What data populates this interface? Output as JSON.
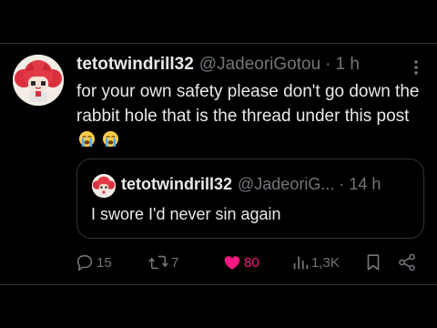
{
  "tweet": {
    "display_name": "tetotwindrill32",
    "handle": "@JadeoriGotou",
    "separator": "·",
    "time": "1 h",
    "text": "for your own safety please don't go down the rabbit hole that is the thread under this post",
    "emoji": "loudly-crying-face-icon"
  },
  "quote": {
    "display_name": "tetotwindrill32",
    "handle": "@JadeoriG...",
    "separator": "·",
    "time": "14 h",
    "text": "I swore I'd never sin again"
  },
  "actions": {
    "replies": "15",
    "reposts": "7",
    "likes": "80",
    "views": "1,3K"
  },
  "colors": {
    "background": "#000000",
    "text": "#e7e9ea",
    "secondary": "#71767b",
    "border": "#2f3336",
    "like": "#f91880"
  }
}
